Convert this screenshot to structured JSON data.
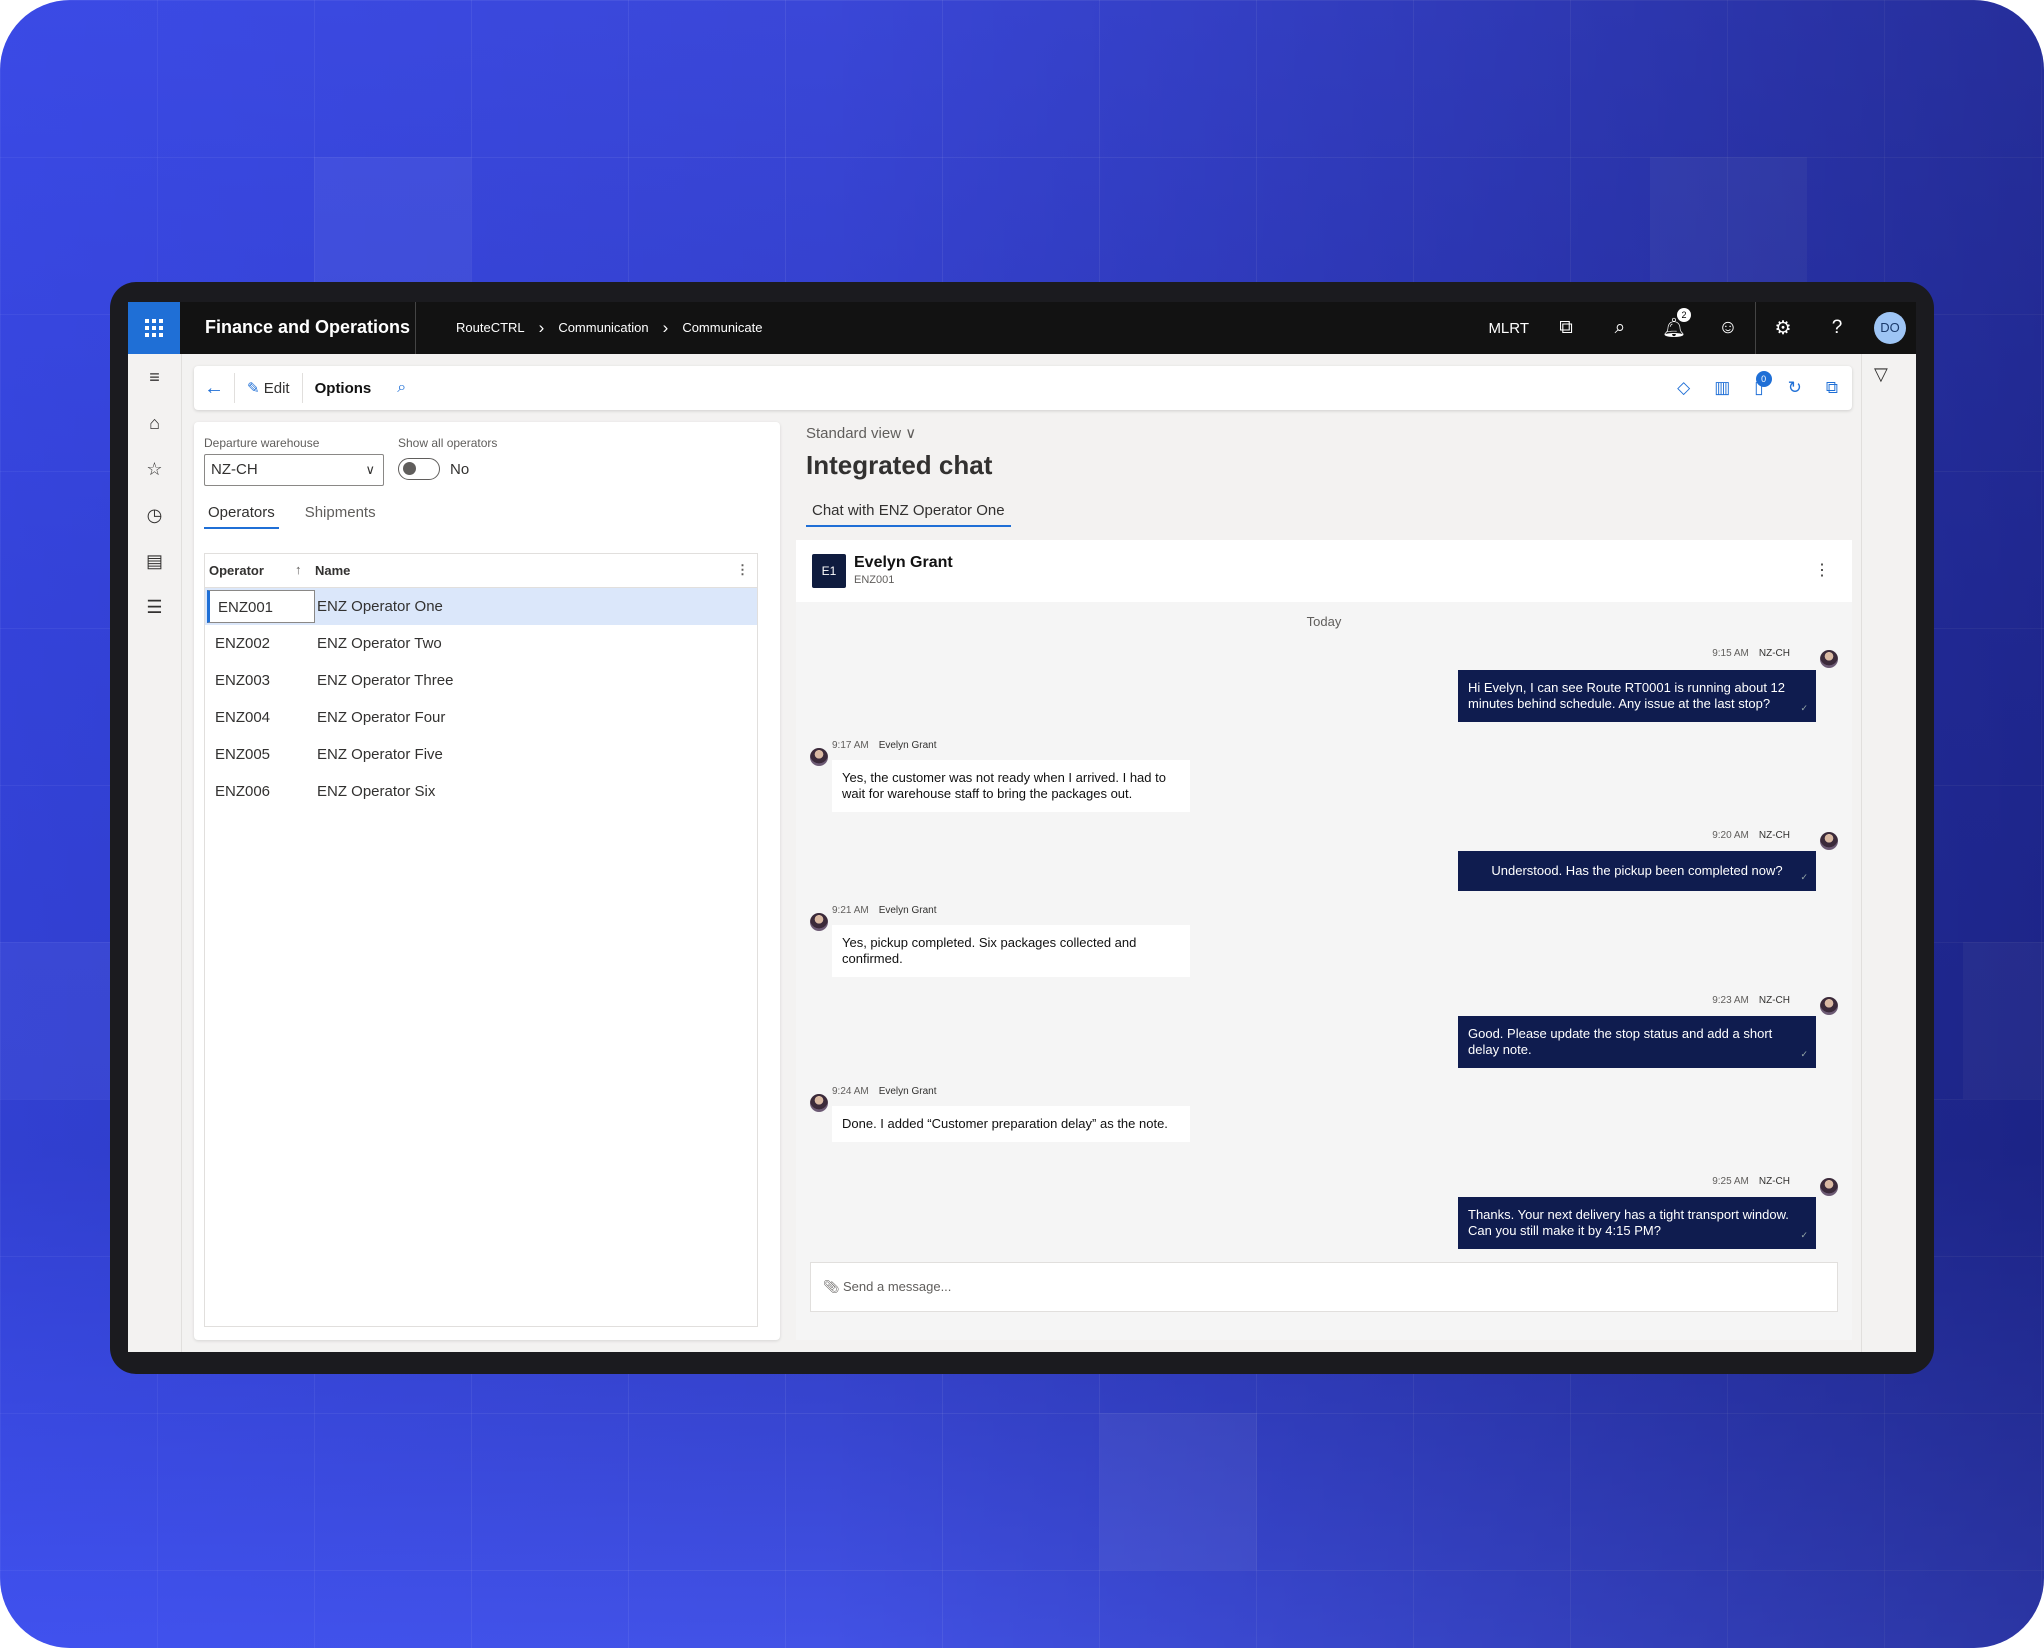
{
  "app": {
    "title": "Finance and Operations",
    "company": "MLRT",
    "user_initials": "DO",
    "notification_count": "2"
  },
  "breadcrumb": [
    "RouteCTRL",
    "Communication",
    "Communicate"
  ],
  "toolbar": {
    "edit": "Edit",
    "options": "Options",
    "badge_count": "0"
  },
  "filters": {
    "warehouse_label": "Departure warehouse",
    "warehouse_value": "NZ-CH",
    "show_all_label": "Show all operators",
    "show_all_value": "No"
  },
  "tabs": [
    "Operators",
    "Shipments"
  ],
  "grid": {
    "headers": [
      "Operator",
      "Name"
    ],
    "rows": [
      {
        "id": "ENZ001",
        "name": "ENZ Operator One"
      },
      {
        "id": "ENZ002",
        "name": "ENZ Operator Two"
      },
      {
        "id": "ENZ003",
        "name": "ENZ Operator Three"
      },
      {
        "id": "ENZ004",
        "name": "ENZ Operator Four"
      },
      {
        "id": "ENZ005",
        "name": "ENZ Operator Five"
      },
      {
        "id": "ENZ006",
        "name": "ENZ Operator Six"
      }
    ]
  },
  "view": {
    "label": "Standard view",
    "title": "Integrated chat",
    "tab": "Chat with ENZ Operator One"
  },
  "chat": {
    "initials": "E1",
    "name": "Evelyn Grant",
    "id": "ENZ001",
    "day": "Today",
    "placeholder": "Send a message...",
    "messages": [
      {
        "dir": "out",
        "time": "9:15 AM",
        "sender": "NZ-CH",
        "text": "Hi Evelyn, I can see Route RT0001 is running about 12 minutes behind schedule. Any issue at the last stop?"
      },
      {
        "dir": "in",
        "time": "9:17 AM",
        "sender": "Evelyn Grant",
        "text": "Yes, the customer was not ready when I arrived. I had to wait for warehouse staff to bring the packages out."
      },
      {
        "dir": "out",
        "time": "9:20 AM",
        "sender": "NZ-CH",
        "text": "Understood. Has the pickup been completed now?"
      },
      {
        "dir": "in",
        "time": "9:21 AM",
        "sender": "Evelyn Grant",
        "text": "Yes, pickup completed. Six packages collected and confirmed."
      },
      {
        "dir": "out",
        "time": "9:23 AM",
        "sender": "NZ-CH",
        "text": "Good. Please update the stop status and add a short delay note."
      },
      {
        "dir": "in",
        "time": "9:24 AM",
        "sender": "Evelyn Grant",
        "text": "Done. I added “Customer preparation delay” as the note."
      },
      {
        "dir": "out",
        "time": "9:25 AM",
        "sender": "NZ-CH",
        "text": "Thanks. Your next delivery has a tight transport window. Can you still make it by 4:15 PM?"
      }
    ]
  }
}
